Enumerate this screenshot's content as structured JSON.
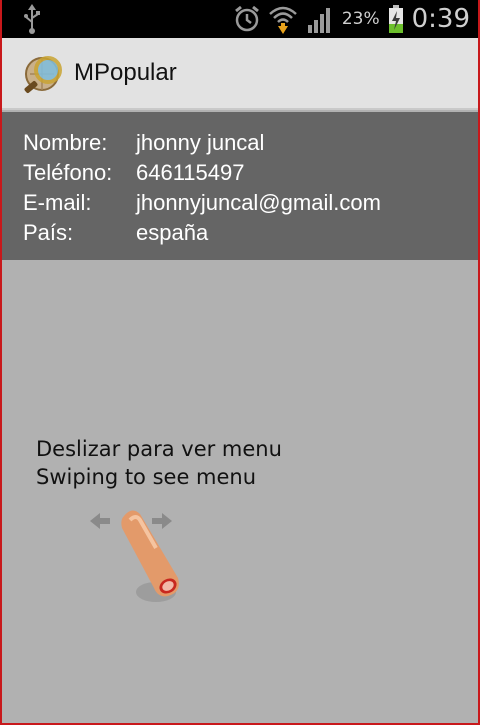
{
  "status_bar": {
    "battery_percent": "23%",
    "time": "0:39",
    "icons": [
      "usb-icon",
      "alarm-icon",
      "wifi-icon",
      "signal-icon",
      "battery-charging-icon"
    ]
  },
  "action_bar": {
    "title": "MPopular",
    "logo_icon": "magnifier-globe-icon"
  },
  "profile": {
    "fields": [
      {
        "label": "Nombre:",
        "value": "jhonny juncal"
      },
      {
        "label": "Teléfono:",
        "value": "646115497"
      },
      {
        "label": "E-mail:",
        "value": "jhonnyjuncal@gmail.com"
      },
      {
        "label": "País:",
        "value": "españa"
      }
    ]
  },
  "hint": {
    "line1": "Deslizar para ver menu",
    "line2": "Swiping to see menu",
    "gesture_icon": "swipe-finger-icon"
  },
  "colors": {
    "statusbar_bg": "#000000",
    "actionbar_bg": "#e2e2e2",
    "info_bg": "#656565",
    "content_bg": "#b1b1b1",
    "frame_border": "#c8181b"
  }
}
